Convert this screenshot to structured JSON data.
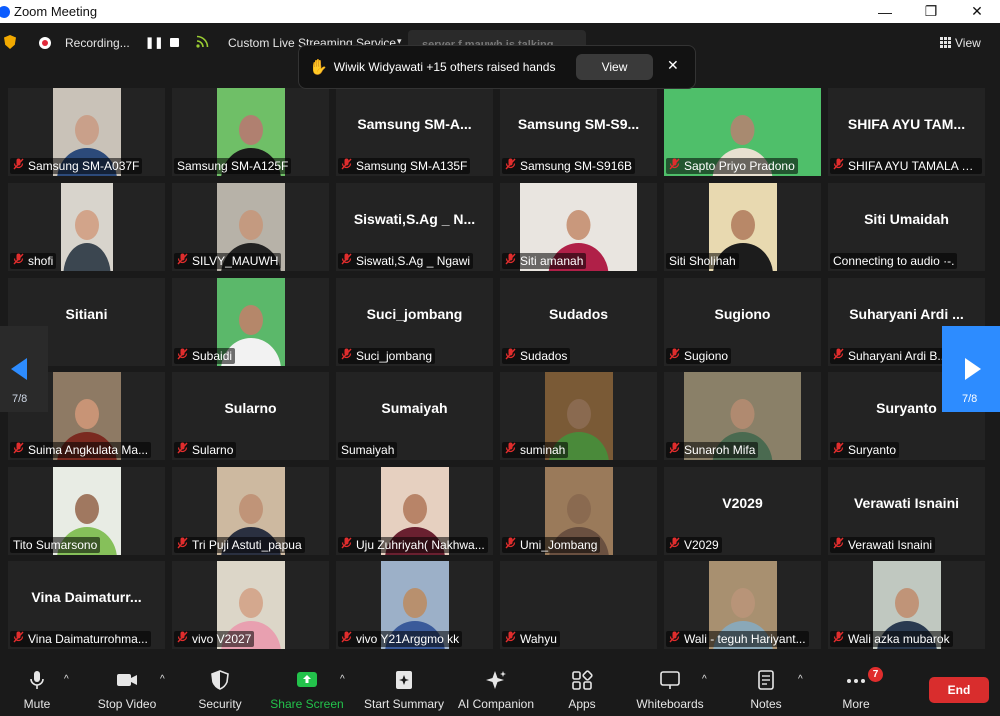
{
  "window": {
    "title": "Zoom Meeting",
    "minimize": "—",
    "maximize": "❐",
    "close": "✕"
  },
  "topbar": {
    "recording_label": "Recording...",
    "pause_symbol": "❚❚",
    "streaming_label": "Custom Live Streaming Service",
    "stream_caret": "▾",
    "speaker_banner": "server f mauwh is talking...",
    "view_label": "View"
  },
  "raised_hands": {
    "text": "Wiwik Widyawati +15 others raised hands",
    "view_button": "View",
    "close": "✕",
    "hand_icon": "✋"
  },
  "pagination": {
    "left_page": "7/8",
    "right_page": "7/8"
  },
  "tiles": [
    {
      "name": "",
      "label": "Samsung SM-A037F",
      "muted": true,
      "video": true,
      "bg": "#c9c2b8",
      "vx": 45,
      "vw": 68,
      "skin": "#c9a08a",
      "cloth": "#2c4a7a"
    },
    {
      "name": "",
      "label": "Samsung SM-A125F",
      "muted": false,
      "video": true,
      "bg": "#6fbf67",
      "vx": 45,
      "vw": 68,
      "skin": "#b08070",
      "cloth": "#1a1a1a"
    },
    {
      "name": "Samsung  SM-A...",
      "label": "Samsung SM-A135F",
      "muted": true,
      "video": false
    },
    {
      "name": "Samsung  SM-S9...",
      "label": "Samsung SM-S916B",
      "muted": true,
      "video": false
    },
    {
      "name": "",
      "label": "Sapto Priyo Pradono",
      "muted": true,
      "video": true,
      "bg": "#4fbf6a",
      "vx": 0,
      "vw": 157,
      "skin": "#a88a70",
      "cloth": "#e8e0d0"
    },
    {
      "name": "SHIFA AYU TAM...",
      "label": "SHIFA AYU TAMALA S...",
      "muted": true,
      "video": false
    },
    {
      "name": "",
      "label": "shofi",
      "muted": true,
      "video": true,
      "bg": "#d8d4cc",
      "vx": 53,
      "vw": 52,
      "skin": "#d2a48a",
      "cloth": "#3b4650"
    },
    {
      "name": "",
      "label": "SILVY_MAUWH",
      "muted": true,
      "video": true,
      "bg": "#b7b2a8",
      "vx": 45,
      "vw": 68,
      "skin": "#c49a80",
      "cloth": "#222"
    },
    {
      "name": "Siswati,S.Ag _ N...",
      "label": "Siswati,S.Ag _ Ngawi",
      "muted": true,
      "video": false
    },
    {
      "name": "",
      "label": "Siti amanah",
      "muted": true,
      "video": true,
      "bg": "#e9e5e0",
      "vx": 20,
      "vw": 117,
      "skin": "#c9987c",
      "cloth": "#b02048"
    },
    {
      "name": "",
      "label": "Siti Sholihah",
      "muted": false,
      "video": true,
      "bg": "#e8d9b0",
      "vx": 45,
      "vw": 68,
      "skin": "#b88868",
      "cloth": "#1c1c1c"
    },
    {
      "name": "Siti Umaidah",
      "label": "Connecting to audio ·-.",
      "muted": false,
      "video": false
    },
    {
      "name": "Sitiani",
      "label": "ani",
      "muted": false,
      "video": false
    },
    {
      "name": "",
      "label": "Subaidi",
      "muted": true,
      "video": true,
      "bg": "#5bb86a",
      "vx": 45,
      "vw": 68,
      "skin": "#b5876a",
      "cloth": "#f2f2f2"
    },
    {
      "name": "Suci_jombang",
      "label": "Suci_jombang",
      "muted": true,
      "video": false
    },
    {
      "name": "Sudados",
      "label": "Sudados",
      "muted": true,
      "video": false
    },
    {
      "name": "Sugiono",
      "label": "Sugiono",
      "muted": true,
      "video": false
    },
    {
      "name": "Suharyani  Ardi ...",
      "label": "Suharyani Ardi B...",
      "muted": true,
      "video": false
    },
    {
      "name": "",
      "label": "Suima Angkulata Ma...",
      "muted": true,
      "video": true,
      "bg": "#8e7a64",
      "vx": 45,
      "vw": 68,
      "skin": "#c89476",
      "cloth": "#7a2a20"
    },
    {
      "name": "Sularno",
      "label": "Sularno",
      "muted": true,
      "video": false
    },
    {
      "name": "Sumaiyah",
      "label": "Sumaiyah",
      "muted": false,
      "video": false
    },
    {
      "name": "",
      "label": "suminah",
      "muted": true,
      "video": true,
      "bg": "#7a5a36",
      "vx": 45,
      "vw": 68,
      "skin": "#8a6a50",
      "cloth": "#4a8a3a"
    },
    {
      "name": "",
      "label": "Sunaroh Mifa",
      "muted": true,
      "video": true,
      "bg": "#8a8068",
      "vx": 20,
      "vw": 117,
      "skin": "#b08a70",
      "cloth": "#4a6a50"
    },
    {
      "name": "Suryanto",
      "label": "Suryanto",
      "muted": true,
      "video": false
    },
    {
      "name": "",
      "label": "Tito Sumarsono",
      "muted": false,
      "video": true,
      "bg": "#e8ece4",
      "vx": 45,
      "vw": 68,
      "skin": "#a07860",
      "cloth": "#86c05a"
    },
    {
      "name": "",
      "label": "Tri Puji Astuti_papua",
      "muted": true,
      "video": true,
      "bg": "#cdb9a0",
      "vx": 45,
      "vw": 68,
      "skin": "#c09478",
      "cloth": "#2a3040"
    },
    {
      "name": "",
      "label": "Uju Zuhriyah( Nakhwa...",
      "muted": true,
      "video": true,
      "bg": "#e6d0c0",
      "vx": 45,
      "vw": 68,
      "skin": "#b88468",
      "cloth": "#6a2030"
    },
    {
      "name": "",
      "label": "Umi_Jombang",
      "muted": true,
      "video": true,
      "bg": "#9a7a5a",
      "vx": 45,
      "vw": 68,
      "skin": "#8a6a50",
      "cloth": "#6a5040"
    },
    {
      "name": "V2029",
      "label": "V2029",
      "muted": true,
      "video": false
    },
    {
      "name": "Verawati Isnaini",
      "label": "Verawati Isnaini",
      "muted": true,
      "video": false
    },
    {
      "name": "Vina  Daimaturr...",
      "label": "Vina Daimaturrohma...",
      "muted": true,
      "video": false
    },
    {
      "name": "",
      "label": "vivo V2027",
      "muted": true,
      "video": true,
      "bg": "#dcd6c8",
      "vx": 45,
      "vw": 68,
      "skin": "#d4a88e",
      "cloth": "#e8a0b0"
    },
    {
      "name": "",
      "label": "vivo Y21Arggmo kk",
      "muted": true,
      "video": true,
      "bg": "#9cb0c8",
      "vx": 45,
      "vw": 68,
      "skin": "#b8906e",
      "cloth": "#3a5a9a"
    },
    {
      "name": "",
      "label": "Wahyu",
      "muted": true,
      "video": false
    },
    {
      "name": "",
      "label": "Wali - teguh Hariyant...",
      "muted": true,
      "video": true,
      "bg": "#a89070",
      "vx": 45,
      "vw": 68,
      "skin": "#b89478",
      "cloth": "#8aa8b8"
    },
    {
      "name": "",
      "label": "Wali azka mubarok",
      "muted": true,
      "video": true,
      "bg": "#c0c8c0",
      "vx": 45,
      "vw": 68,
      "skin": "#c09478",
      "cloth": "#2a3a50"
    }
  ],
  "toolbar": {
    "mute": "Mute",
    "stop_video": "Stop Video",
    "security": "Security",
    "share_screen": "Share Screen",
    "start_summary": "Start Summary",
    "ai_companion": "AI Companion",
    "apps": "Apps",
    "whiteboards": "Whiteboards",
    "notes": "Notes",
    "more": "More",
    "more_badge": "7",
    "end": "End",
    "caret": "^"
  },
  "colors": {
    "accent": "#2d8cff",
    "share_green": "#23c24b",
    "end_red": "#d92d2d",
    "tile_bg": "#232323",
    "muted_red": "#e02d2d"
  }
}
